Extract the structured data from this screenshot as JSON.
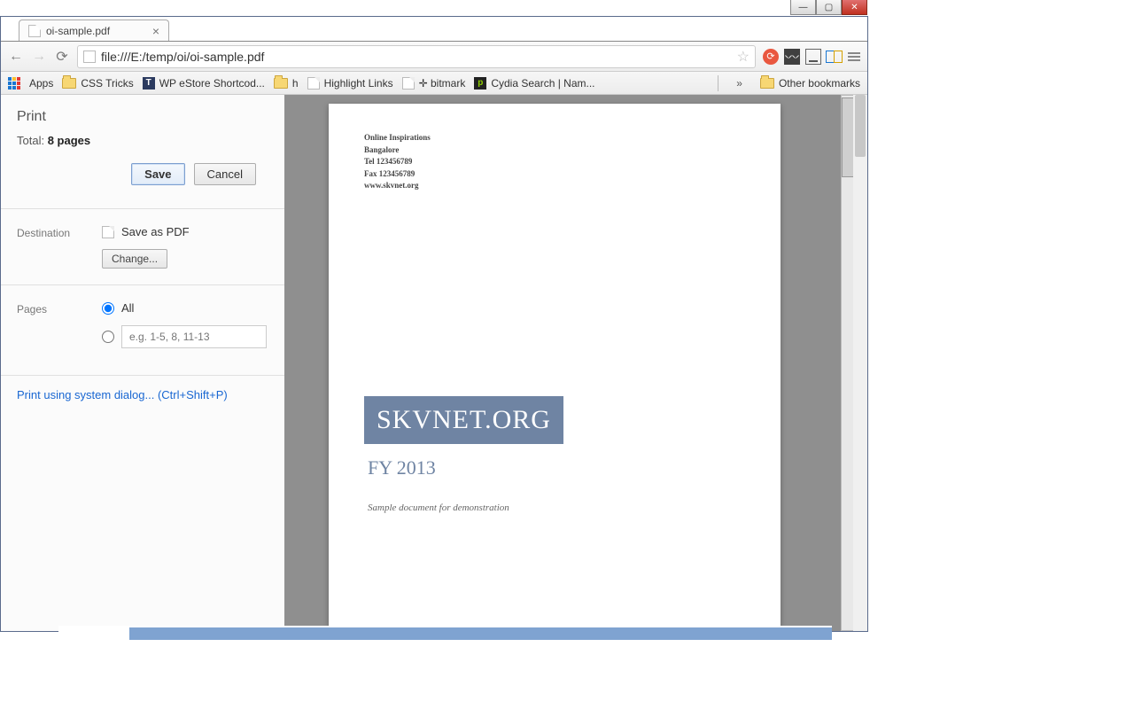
{
  "tab": {
    "title": "oi-sample.pdf"
  },
  "address": {
    "url": "file:///E:/temp/oi/oi-sample.pdf"
  },
  "bookmarks": {
    "apps": "Apps",
    "items": [
      "CSS Tricks",
      "WP eStore Shortcod...",
      "h",
      "Highlight Links",
      "✛ bitmark",
      "Cydia Search | Nam..."
    ],
    "chevron": "»",
    "other": "Other bookmarks"
  },
  "print": {
    "title": "Print",
    "total_label": "Total:",
    "total_value": "8 pages",
    "save": "Save",
    "cancel": "Cancel",
    "destination_label": "Destination",
    "destination_value": "Save as PDF",
    "change": "Change...",
    "pages_label": "Pages",
    "pages_all": "All",
    "pages_placeholder": "e.g. 1-5, 8, 11-13",
    "system_link": "Print using system dialog... (Ctrl+Shift+P)"
  },
  "doc": {
    "org": "Online Inspirations",
    "city": "Bangalore",
    "tel": "Tel 123456789",
    "fax": "Fax 123456789",
    "site": "www.skvnet.org",
    "banner": "SKVNET.ORG",
    "subtitle": "FY 2013",
    "note": "Sample document for demonstration"
  }
}
